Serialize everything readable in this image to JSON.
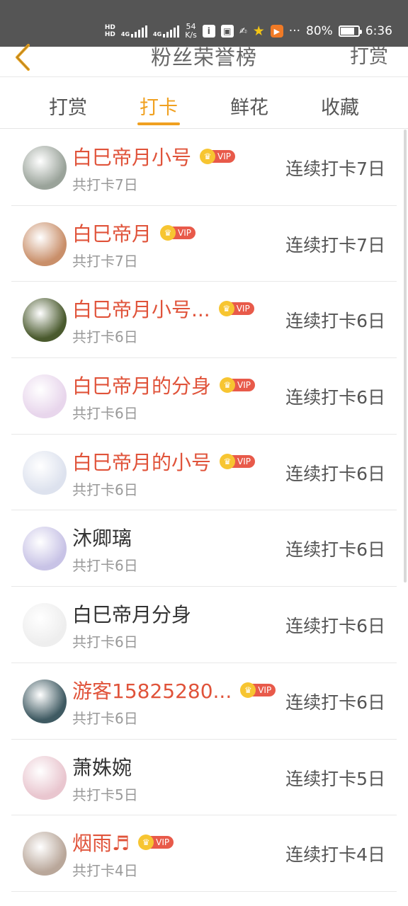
{
  "status_bar": {
    "hd1": "HD",
    "hd2": "HD",
    "net1": "4G",
    "net2": "4G",
    "speed_value": "54",
    "speed_unit": "K/s",
    "battery": "80%",
    "battery_level": 0.8,
    "time": "6:36",
    "more": "···"
  },
  "header": {
    "title": "粉丝荣誉榜",
    "action": "打赏"
  },
  "tabs": [
    {
      "label": "打赏",
      "active": false
    },
    {
      "label": "打卡",
      "active": true
    },
    {
      "label": "鲜花",
      "active": false
    },
    {
      "label": "收藏",
      "active": false
    }
  ],
  "vip_label": "VIP",
  "fans": [
    {
      "name": "白巳帝月小号",
      "vip": true,
      "total": "共打卡7日",
      "streak": "连续打卡7日",
      "avatar_color": "#9aa39a"
    },
    {
      "name": "白巳帝月",
      "vip": true,
      "total": "共打卡7日",
      "streak": "连续打卡7日",
      "avatar_color": "#c98f6a"
    },
    {
      "name": "白巳帝月小号...",
      "vip": true,
      "total": "共打卡6日",
      "streak": "连续打卡6日",
      "avatar_color": "#4a5a2e"
    },
    {
      "name": "白巳帝月的分身",
      "vip": true,
      "total": "共打卡6日",
      "streak": "连续打卡6日",
      "avatar_color": "#e8d6ec"
    },
    {
      "name": "白巳帝月的小号",
      "vip": true,
      "total": "共打卡6日",
      "streak": "连续打卡6日",
      "avatar_color": "#dde2ee"
    },
    {
      "name": "沐卿璃",
      "vip": false,
      "total": "共打卡6日",
      "streak": "连续打卡6日",
      "avatar_color": "#c8c3e6"
    },
    {
      "name": "白巳帝月分身",
      "vip": false,
      "total": "共打卡6日",
      "streak": "连续打卡6日",
      "avatar_color": "#eeeeee"
    },
    {
      "name": "游客15825280...",
      "vip": true,
      "total": "共打卡6日",
      "streak": "连续打卡6日",
      "avatar_color": "#3f5a62"
    },
    {
      "name": "萧姝婉",
      "vip": false,
      "total": "共打卡5日",
      "streak": "连续打卡5日",
      "avatar_color": "#e9c6cf"
    },
    {
      "name": "烟雨♬",
      "vip": true,
      "total": "共打卡4日",
      "streak": "连续打卡4日",
      "avatar_color": "#b9a79a"
    }
  ]
}
